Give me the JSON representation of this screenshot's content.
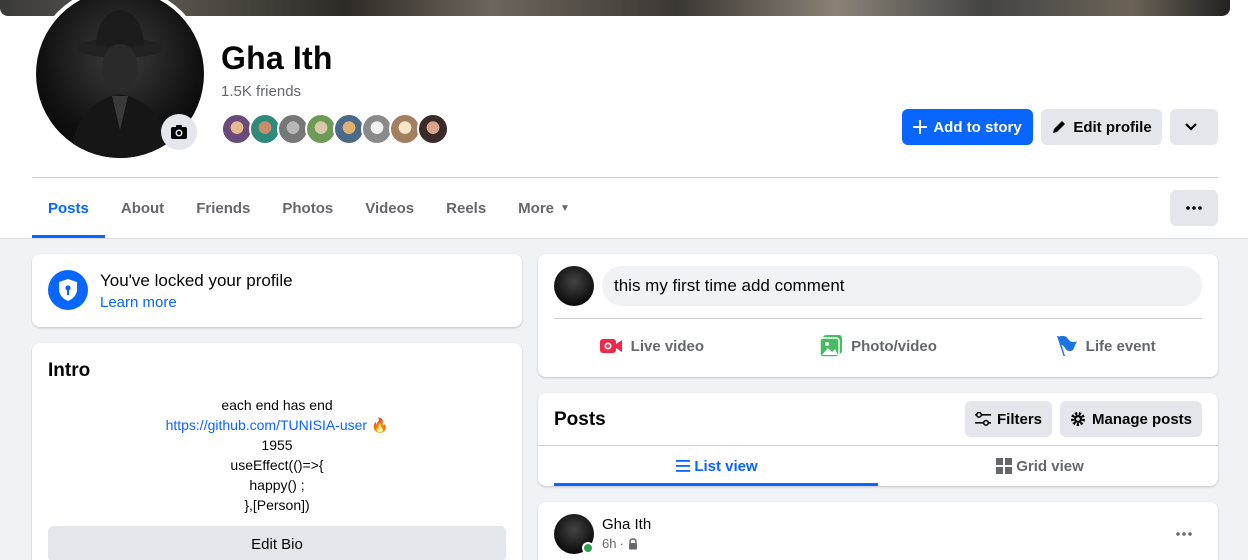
{
  "profile": {
    "name": "Gha Ith",
    "friends_count": "1.5K friends"
  },
  "actions": {
    "add_story": "Add to story",
    "edit_profile": "Edit profile"
  },
  "tabs": [
    {
      "label": "Posts"
    },
    {
      "label": "About"
    },
    {
      "label": "Friends"
    },
    {
      "label": "Photos"
    },
    {
      "label": "Videos"
    },
    {
      "label": "Reels"
    },
    {
      "label": "More"
    }
  ],
  "lock_notice": {
    "title": "You've locked your profile",
    "link": "Learn more"
  },
  "intro": {
    "title": "Intro",
    "bio_lines": [
      "each end has end",
      "https://github.com/TUNISIA-user",
      "1955",
      "useEffect(()=>{",
      "happy() ;",
      "},[Person])"
    ],
    "bio_emoji": "🔥",
    "edit_bio": "Edit Bio"
  },
  "composer": {
    "input_value": "this my first time add comment",
    "live_video": "Live video",
    "photo_video": "Photo/video",
    "life_event": "Life event"
  },
  "posts_section": {
    "title": "Posts",
    "filters": "Filters",
    "manage_posts": "Manage posts",
    "list_view": "List view",
    "grid_view": "Grid view"
  },
  "post": {
    "author": "Gha Ith",
    "time": "6h",
    "separator": "·"
  },
  "colors": {
    "accent": "#0866ff",
    "online": "#31a24c",
    "live_red": "#f02849",
    "photo_green": "#45bd62",
    "life_blue": "#1b74e4"
  }
}
